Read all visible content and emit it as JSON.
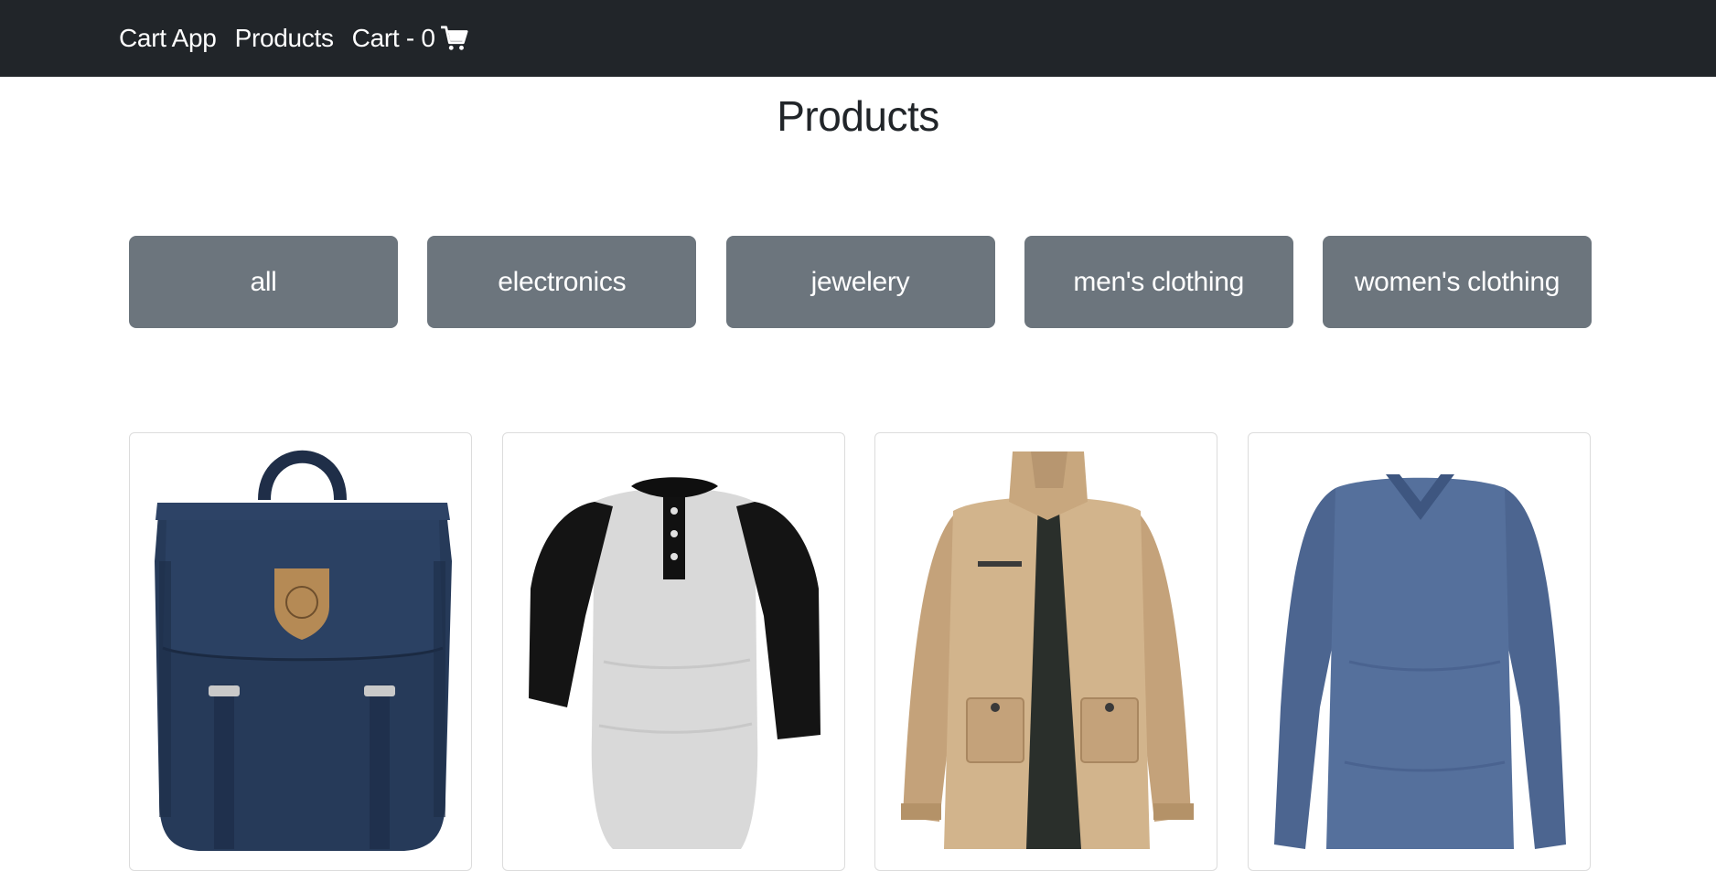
{
  "navbar": {
    "brand": "Cart App",
    "products_link": "Products",
    "cart_link": "Cart - 0",
    "cart_icon": "shopping-cart-icon"
  },
  "page": {
    "title": "Products"
  },
  "filters": [
    {
      "label": "all"
    },
    {
      "label": "electronics"
    },
    {
      "label": "jewelery"
    },
    {
      "label": "men's clothing"
    },
    {
      "label": "women's clothing"
    }
  ],
  "products": [
    {
      "image": "navy-backpack-image"
    },
    {
      "image": "raglan-henley-shirt-image"
    },
    {
      "image": "khaki-jacket-image"
    },
    {
      "image": "blue-long-sleeve-tee-image"
    }
  ],
  "colors": {
    "navbar_bg": "#212529",
    "filter_bg": "#6c757d",
    "text_dark": "#212529"
  }
}
